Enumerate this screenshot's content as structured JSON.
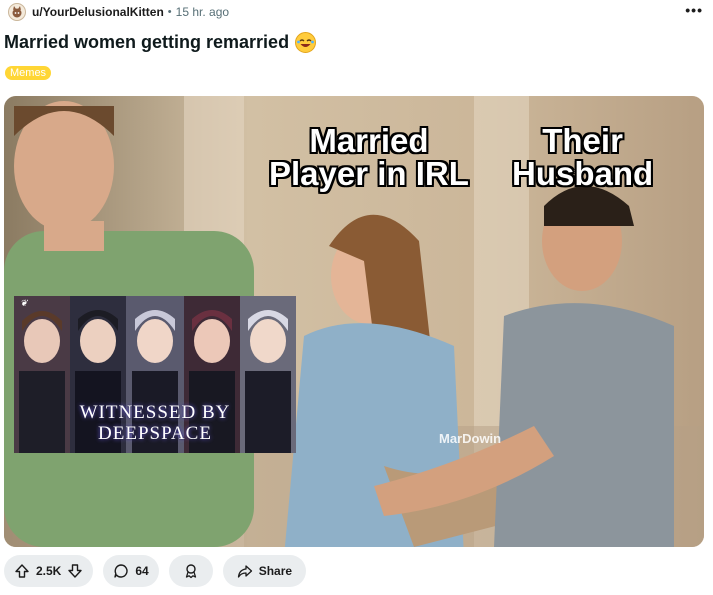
{
  "post": {
    "username": "u/YourDelusionalKitten",
    "separator": "•",
    "time": "15 hr. ago",
    "title": "Married women getting remarried",
    "flair": "Memes",
    "more": "•••"
  },
  "image": {
    "caption_left_line1": "Married",
    "caption_left_line2": "Player in IRL",
    "caption_right_line1": "Their",
    "caption_right_line2": "Husband",
    "watermark": "MarDowin",
    "inset_line1": "WITNESSED BY",
    "inset_line2": "DEEPSPACE"
  },
  "actions": {
    "upvotes": "2.5K",
    "comments": "64",
    "share": "Share"
  },
  "colors": {
    "flair_bg": "#ffd635",
    "pill_bg": "#eaedef"
  }
}
